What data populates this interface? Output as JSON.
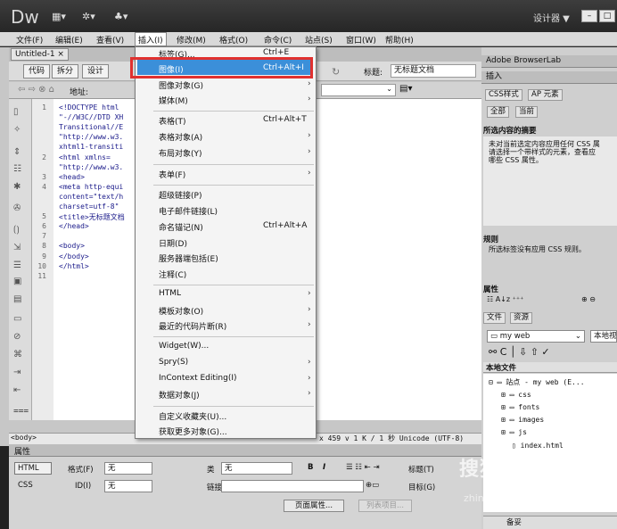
{
  "app": {
    "logo": "Dw",
    "designer": "设计器 ▼"
  },
  "menubar": [
    "文件(F)",
    "编辑(E)",
    "查看(V)",
    "插入(I)",
    "修改(M)",
    "格式(O)",
    "命令(C)",
    "站点(S)",
    "窗口(W)",
    "帮助(H)"
  ],
  "doc": {
    "tab": "Untitled-1 ×",
    "views": [
      "代码",
      "拆分",
      "设计"
    ],
    "address": "地址:",
    "title_label": "标题:",
    "title_value": "无标题文档"
  },
  "code_lines": [
    {
      "n": "1",
      "t": "<!DOCTYPE html"
    },
    {
      "n": "",
      "t": "\"-//W3C//DTD XH"
    },
    {
      "n": "",
      "t": "Transitional//E"
    },
    {
      "n": "",
      "t": "\"http://www.w3."
    },
    {
      "n": "",
      "t": "xhtml1-transiti"
    },
    {
      "n": "2",
      "t": "<html xmlns="
    },
    {
      "n": "",
      "t": "\"http://www.w3."
    },
    {
      "n": "3",
      "t": "<head>"
    },
    {
      "n": "4",
      "t": "<meta http-equi"
    },
    {
      "n": "",
      "t": "content=\"text/h"
    },
    {
      "n": "",
      "t": "charset=utf-8\""
    },
    {
      "n": "5",
      "t": "<title>无标题文档"
    },
    {
      "n": "6",
      "t": "</head>"
    },
    {
      "n": "7",
      "t": ""
    },
    {
      "n": "8",
      "t": "<body>"
    },
    {
      "n": "9",
      "t": "</body>"
    },
    {
      "n": "10",
      "t": "</html>"
    },
    {
      "n": "11",
      "t": ""
    }
  ],
  "status": {
    "tag": "<body>",
    "info": "x 459 v 1 K / 1 秒 Unicode (UTF-8)"
  },
  "props": {
    "title": "属性",
    "html": "HTML",
    "css": "CSS",
    "format_label": "格式(F)",
    "format_value": "无",
    "class_label": "类",
    "class_value": "无",
    "id_label": "ID(I)",
    "id_value": "无",
    "link_label": "链接(L)",
    "target_label": "目标(G)",
    "title_label": "标题(T)",
    "page_props": "页面属性...",
    "list_items": "列表项目..."
  },
  "insert_menu": [
    {
      "label": "标签(G)...",
      "sc": "Ctrl+E"
    },
    {
      "label": "图像(I)",
      "sc": "Ctrl+Alt+I"
    },
    {
      "label": "图像对象(G)",
      "arrow": true
    },
    {
      "label": "媒体(M)",
      "arrow": true
    },
    {
      "label": "表格(T)",
      "sc": "Ctrl+Alt+T"
    },
    {
      "label": "表格对象(A)",
      "arrow": true
    },
    {
      "label": "布局对象(Y)",
      "arrow": true
    },
    {
      "label": "表单(F)",
      "arrow": true
    },
    {
      "label": "超级链接(P)"
    },
    {
      "label": "电子邮件链接(L)"
    },
    {
      "label": "命名锚记(N)",
      "sc": "Ctrl+Alt+A"
    },
    {
      "label": "日期(D)"
    },
    {
      "label": "服务器端包括(E)"
    },
    {
      "label": "注释(C)"
    },
    {
      "label": "HTML",
      "arrow": true
    },
    {
      "label": "模板对象(O)",
      "arrow": true
    },
    {
      "label": "最近的代码片断(R)",
      "arrow": true
    },
    {
      "label": "Widget(W)..."
    },
    {
      "label": "Spry(S)",
      "arrow": true
    },
    {
      "label": "InContext Editing(I)",
      "arrow": true
    },
    {
      "label": "数据对象(J)",
      "arrow": true
    },
    {
      "label": "自定义收藏夹(U)..."
    },
    {
      "label": "获取更多对象(G)..."
    }
  ],
  "right": {
    "browserlab": "Adobe BrowserLab",
    "insert": "插入",
    "css_tab": "CSS样式",
    "ap_tab": "AP 元素",
    "all": "全部",
    "current": "当前",
    "summary_title": "所选内容的摘要",
    "summary_text": [
      "未对当前选定内容应用任何 CSS 属",
      "请选择一个带样式的元素，查看应",
      "哪些 CSS 属性。"
    ],
    "rules_title": "规则",
    "rules_text": "所选标签没有应用 CSS 规则。",
    "props_title": "属性",
    "files_tab": "文件",
    "assets_tab": "资源",
    "site": "my web",
    "view": "本地视图",
    "local_files": "本地文件",
    "tree": [
      "站点 - my web (E...",
      "css",
      "fonts",
      "images",
      "js",
      "index.html"
    ],
    "bottom": "备妥"
  },
  "watermark": {
    "text": "搜狗指南",
    "url": "zhinan.sogou.com"
  }
}
